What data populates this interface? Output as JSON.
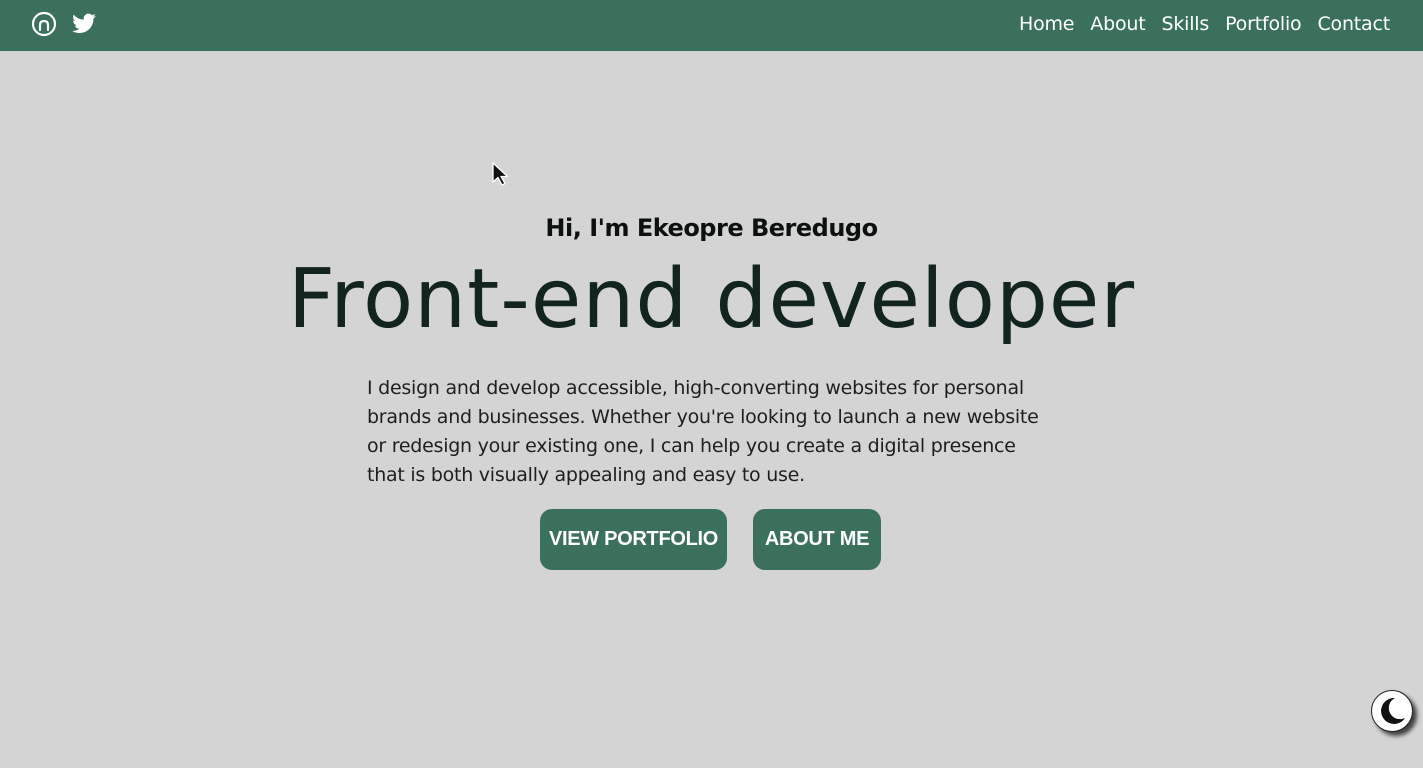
{
  "header": {
    "social_icons": [
      "github-icon",
      "twitter-icon"
    ],
    "nav": [
      "Home",
      "About",
      "Skills",
      "Portfolio",
      "Contact"
    ]
  },
  "hero": {
    "greeting": "Hi, I'm Ekeopre Beredugo",
    "headline": "Front-end developer",
    "description": "I design and develop accessible, high-converting websites for personal brands and businesses. Whether you're looking to launch a new website or redesign your existing one, I can help you create a digital presence that is both visually appealing and easy to use.",
    "buttons": {
      "portfolio": "VIEW PORTFOLIO",
      "about": "ABOUT ME"
    }
  },
  "theme_toggle": {
    "icon": "moon-icon"
  },
  "colors": {
    "accent": "#3b705c",
    "background": "#d4d4d4",
    "headline": "#112420"
  }
}
